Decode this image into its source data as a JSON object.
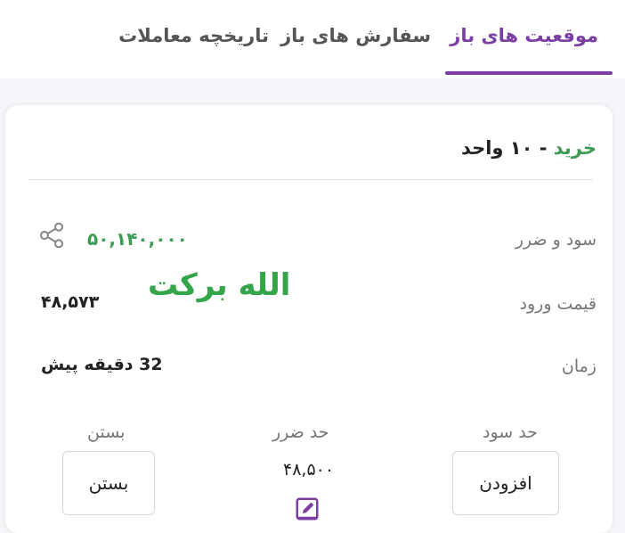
{
  "tabs": [
    {
      "label": "موقعیت های باز",
      "active": true
    },
    {
      "label": "سفارش های باز",
      "active": false
    },
    {
      "label": "تاریخچه معاملات",
      "active": false
    }
  ],
  "position": {
    "side": "خرید",
    "separator": " - ",
    "quantity": "۱۰ واحد",
    "pnl_label": "سود و ضرر",
    "pnl_value": "۵۰,۱۴۰,۰۰۰",
    "entry_label": "قیمت ورود",
    "entry_value": "۴۸,۵۷۳",
    "time_label": "زمان",
    "time_value": "32 دقیقه پیش",
    "take_profit_label": "حد سود",
    "take_profit_button": "افزودن",
    "stop_loss_label": "حد ضرر",
    "stop_loss_value": "۴۸,۵۰۰",
    "close_label": "بستن",
    "close_button": "بستن"
  },
  "overlay_text": "الله برکت",
  "colors": {
    "accent": "#7b3fa3",
    "buy_green": "#3e9b55",
    "overlay_green": "#35a54a"
  },
  "icons": {
    "share": "share-icon",
    "edit": "edit-icon"
  }
}
